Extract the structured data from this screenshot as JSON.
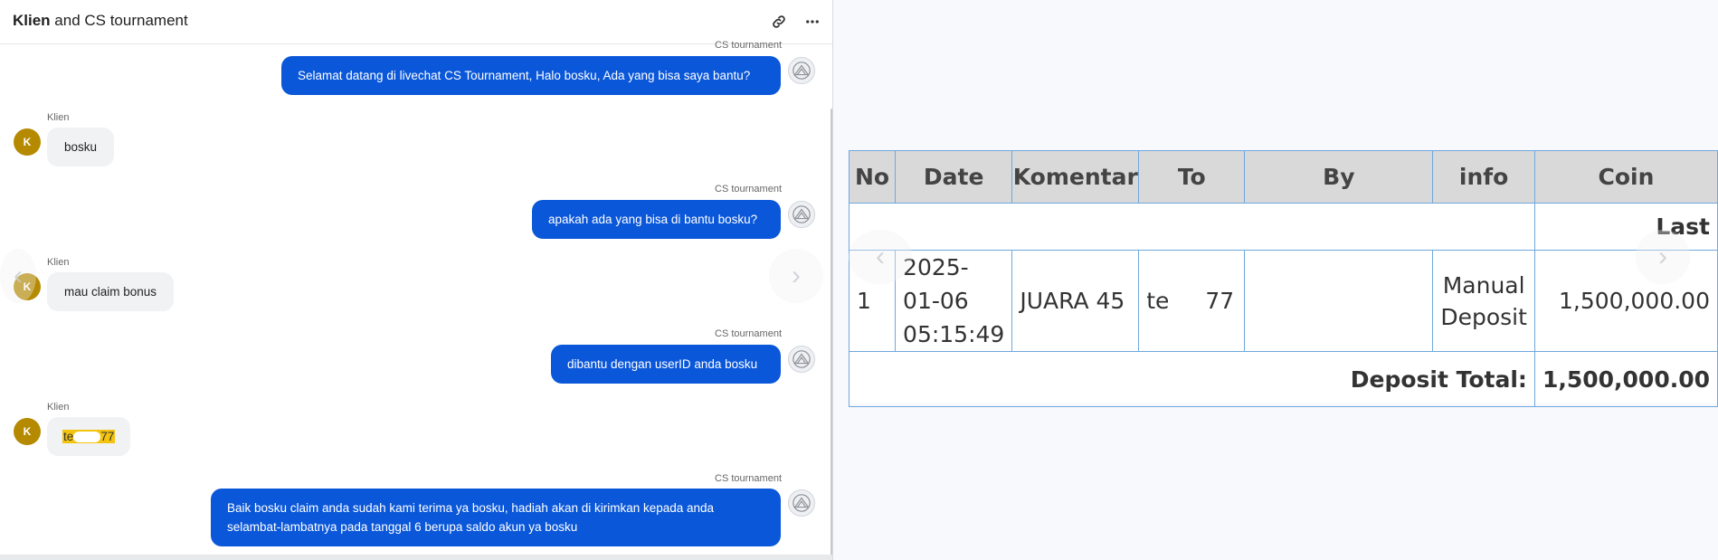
{
  "chat": {
    "title_bold": "Klien",
    "title_rest": " and CS tournament",
    "messages": [
      {
        "sender": "CS tournament",
        "text": "Selamat datang di livechat CS Tournament, Halo bosku, Ada yang bisa saya bantu?"
      },
      {
        "sender": "Klien",
        "text": "bosku"
      },
      {
        "sender": "CS tournament",
        "text": "apakah ada yang bisa di bantu bosku?"
      },
      {
        "sender": "Klien",
        "text": "mau claim bonus"
      },
      {
        "sender": "CS tournament",
        "text": "dibantu dengan userID anda bosku"
      },
      {
        "sender": "Klien",
        "text_prefix": "te",
        "text_suffix": "77"
      },
      {
        "sender": "CS tournament",
        "text_line1": "Baik bosku claim anda sudah kami terima ya bosku, hadiah akan di kirimkan kepada anda",
        "text_line2": "selambat-lambatnya pada tanggal 6 berupa saldo akun ya bosku"
      }
    ],
    "avatar_letter": "K",
    "icons": {
      "link": "link-icon",
      "more": "more-horizontal-icon"
    }
  },
  "report": {
    "headers": [
      "No",
      "Date",
      "Komentar",
      "To",
      "By",
      "info",
      "Coin"
    ],
    "last_label": "Last",
    "rows": [
      {
        "no": "1",
        "date_line1": "2025-",
        "date_line2": "01-06",
        "date_line3": "05:15:49",
        "komentar": "JUARA 45",
        "to_prefix": "te",
        "to_suffix": "77",
        "by": "",
        "info_line1": "Manual",
        "info_line2": "Deposit",
        "coin": "1,500,000.00"
      }
    ],
    "total_label": "Deposit Total:",
    "total_value": "1,500,000.00",
    "colors": {
      "green": "#1e8a1e",
      "header_bg": "#d9d9d9",
      "border": "#6fa8dc"
    }
  }
}
